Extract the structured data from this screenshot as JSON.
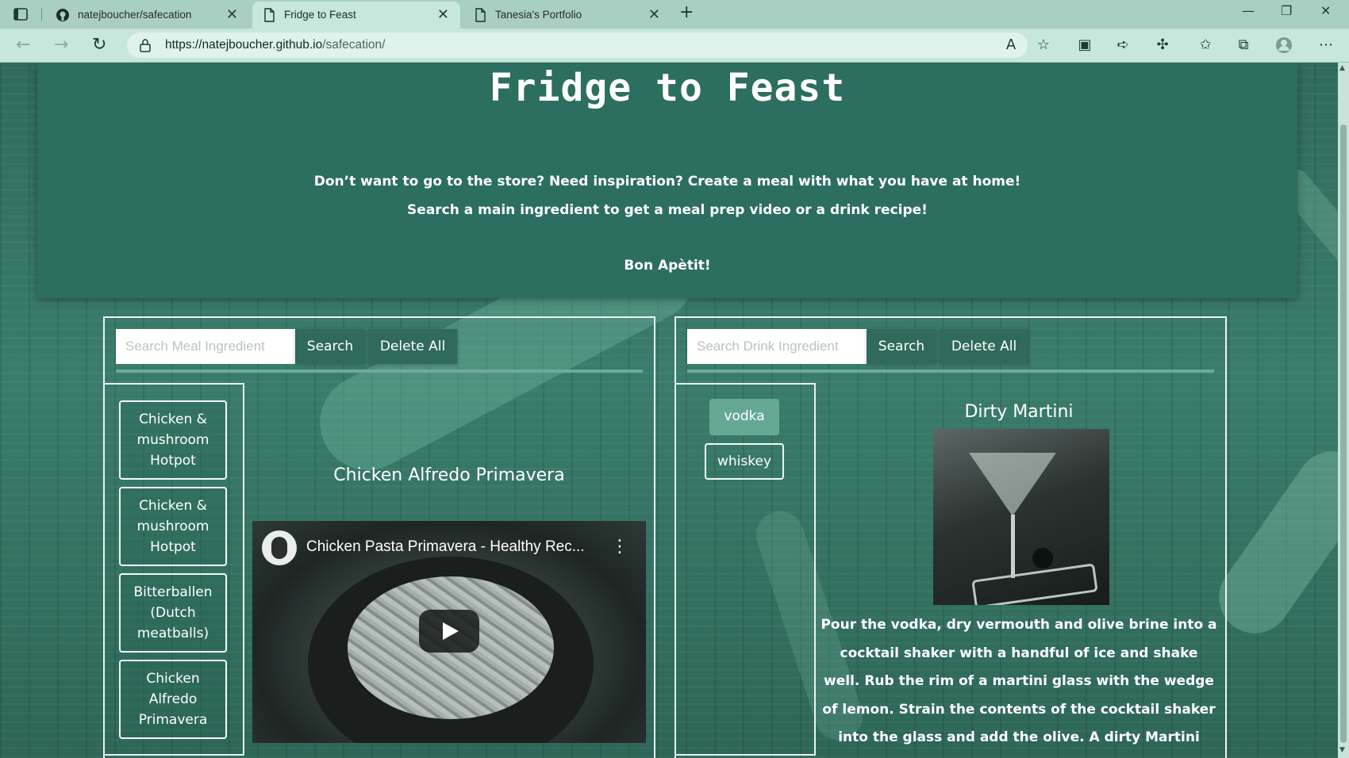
{
  "browser": {
    "tabs": [
      {
        "label": "natejboucher/safecation",
        "icon": "github-icon",
        "active": false
      },
      {
        "label": "Fridge to Feast",
        "icon": "page-icon",
        "active": true
      },
      {
        "label": "Tanesia's Portfolio",
        "icon": "page-icon",
        "active": false
      }
    ],
    "url_domain": "https://natejboucher.github.io",
    "url_path": "/safecation/"
  },
  "hero": {
    "title": "Fridge to Feast",
    "line1": "Don’t want to go to the store? Need inspiration? Create a meal with what you have at home!",
    "line2": "Search a main ingredient to get a meal prep video or a drink recipe!",
    "line3": "Bon Apètit!"
  },
  "meal": {
    "search_placeholder": "Search Meal Ingredient",
    "search_label": "Search",
    "delete_label": "Delete All",
    "history": [
      "Chicken & mushroom Hotpot",
      "Chicken & mushroom Hotpot",
      "Bitterballen (Dutch meatballs)",
      "Chicken Alfredo Primavera"
    ],
    "result_title": "Chicken Alfredo Primavera",
    "video_title": "Chicken Pasta Primavera - Healthy Rec..."
  },
  "drink": {
    "search_placeholder": "Search Drink Ingredient",
    "search_label": "Search",
    "delete_label": "Delete All",
    "history": [
      "vodka",
      "whiskey"
    ],
    "result_title": "Dirty Martini",
    "instructions": "Pour the vodka, dry vermouth and olive brine into a cocktail shaker with a handful of ice and shake well. Rub the rim of a martini glass with the wedge of lemon. Strain the contents of the cocktail shaker into the glass and add the olive. A dirty Martini contains a splash of olive brine or olive juice and is"
  }
}
